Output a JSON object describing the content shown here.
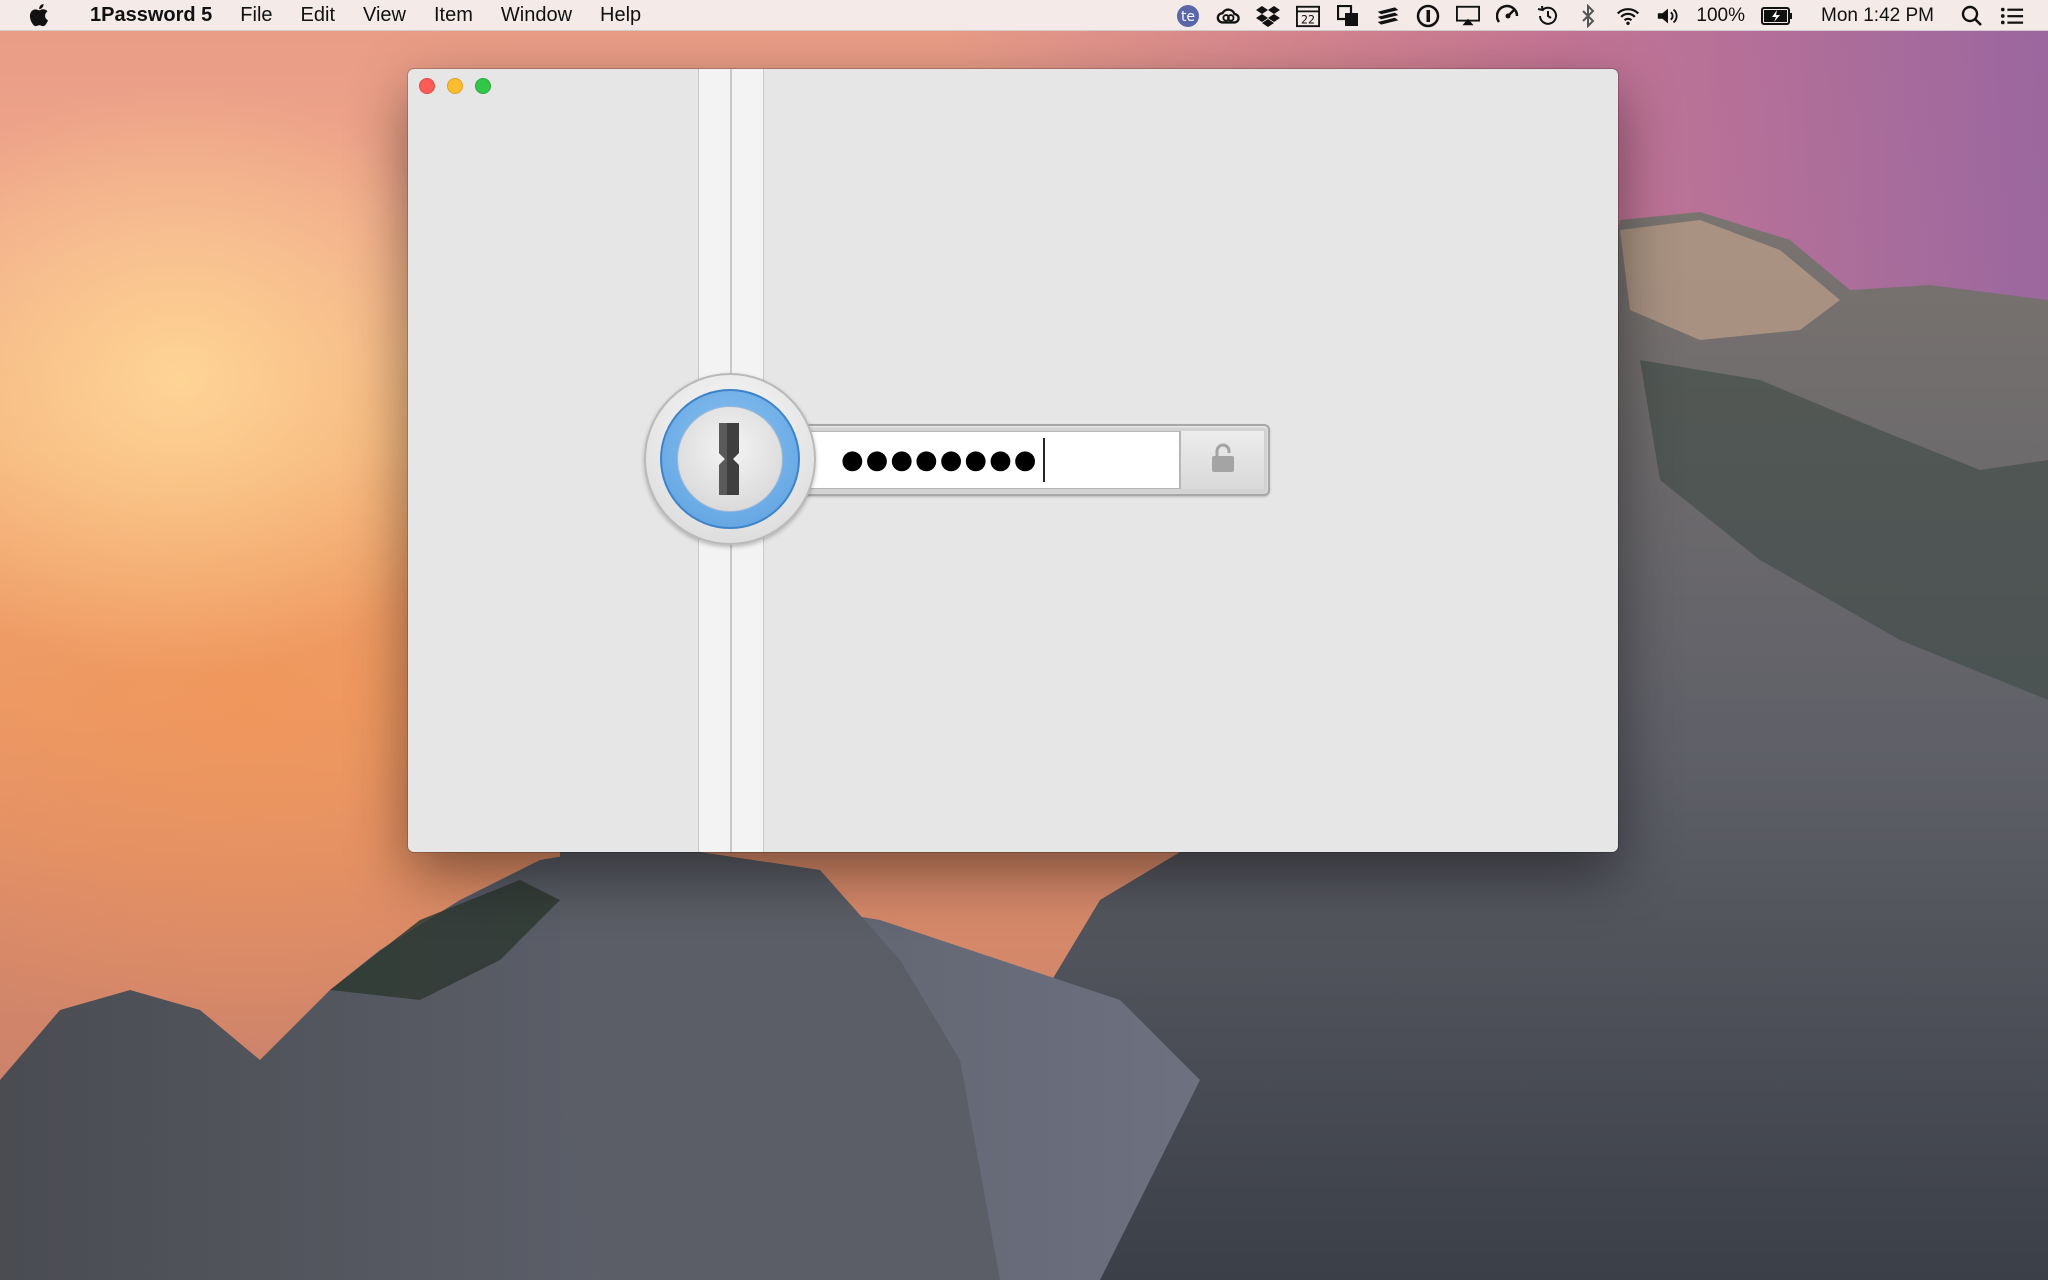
{
  "menubar": {
    "app_name": "1Password 5",
    "menus": [
      "File",
      "Edit",
      "View",
      "Item",
      "Window",
      "Help"
    ],
    "status_icons": [
      "textexpander-icon",
      "creative-cloud-icon",
      "dropbox-icon",
      "calendar-icon",
      "copy-icon",
      "stack-icon",
      "onepassword-mini-icon",
      "airplay-icon",
      "istat-icon",
      "time-machine-icon",
      "bluetooth-icon",
      "wifi-icon",
      "volume-icon"
    ],
    "calendar_day": "22",
    "battery_percent": "100%",
    "clock": "Mon 1:42 PM"
  },
  "window": {
    "title": "",
    "password_mask": "●●●●●●●●",
    "password_length": 8,
    "unlock_icon": "unlock-icon",
    "logo_icon": "onepassword-keyhole-icon"
  },
  "colors": {
    "window_bg": "#e6e6e6",
    "dial_blue": "#5a9fe0",
    "close": "#fc5b57",
    "minimize": "#fdbd2f",
    "maximize": "#33c648"
  }
}
